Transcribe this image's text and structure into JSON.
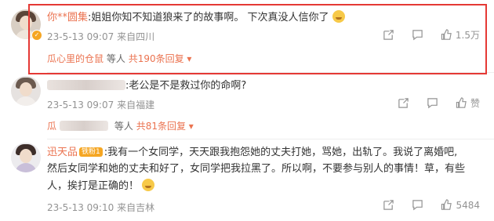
{
  "comments": [
    {
      "name": "你**圆集",
      "text": ":姐姐你知不知道狼来了的故事啊。 下次真没人信你了",
      "time": "23-5-13 09:07",
      "location": "来自四川",
      "likes": "1.5万",
      "reply_name": "瓜心里的仓鼠",
      "reply_suffix": "等人",
      "reply_count": "共190条回复",
      "reply_arrow": "▾"
    },
    {
      "name": "",
      "text": ":老公是不是救过你的命啊?",
      "time": "23-5-13 09:07",
      "location": "来自福建",
      "likes": "赞",
      "reply_name": "瓜",
      "reply_suffix": "等人",
      "reply_count": "共81条回复",
      "reply_arrow": "▾"
    },
    {
      "name": "迅天品",
      "badge": "铁粉1",
      "text_lines": [
        ":我有一个女同学，天天跟我抱怨她的丈夫打她，骂她，出轨了。我说了离婚吧,",
        "然后女同学和她的丈夫和好了，女同学把我拉黑了。所以啊，不要参与别人的事情！草，有些",
        "人，挨打是正确的！"
      ],
      "time": "23-5-13 09:10",
      "location": "来自吉林",
      "likes": "5484"
    }
  ],
  "icons": [
    "share-icon",
    "comment-icon",
    "like-icon",
    "verified-icon"
  ],
  "colors": {
    "accent": "#eb7350",
    "highlight": "#e53935",
    "meta": "#939393"
  }
}
